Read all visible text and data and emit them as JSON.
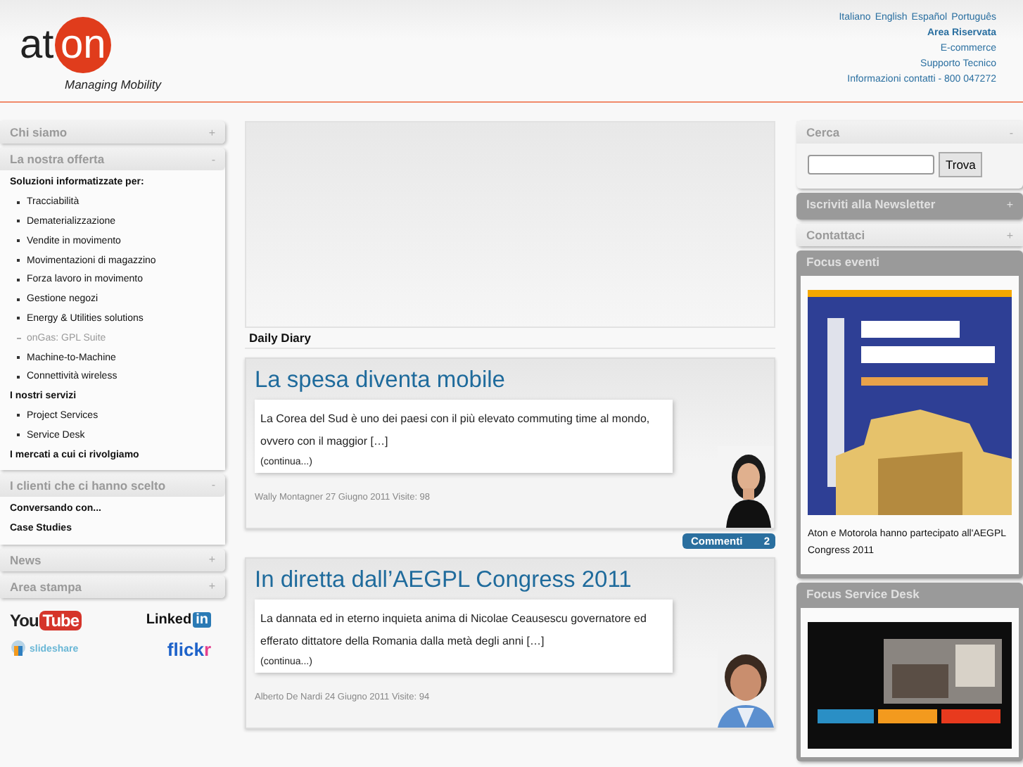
{
  "header": {
    "logo": {
      "text_before": "at",
      "text_circle": "on",
      "tagline": "Managing Mobility"
    },
    "languages": [
      "Italiano",
      "English",
      "Español",
      "Português"
    ],
    "links": [
      {
        "label": "Area Riservata",
        "bold": true
      },
      {
        "label": "E-commerce",
        "bold": false
      },
      {
        "label": "Supporto Tecnico",
        "bold": false
      },
      {
        "label": "Informazioni contatti - 800 047272",
        "bold": false
      }
    ]
  },
  "left_sidebar": {
    "sections": [
      {
        "title": "Chi siamo",
        "toggle": "+",
        "expanded": false
      },
      {
        "title": "La nostra offerta",
        "toggle": "-",
        "expanded": true,
        "items": [
          {
            "kind": "heading",
            "label": "Soluzioni informatizzate per:"
          },
          {
            "kind": "bullet",
            "label": "Tracciabilità"
          },
          {
            "kind": "bullet",
            "label": "Dematerializzazione"
          },
          {
            "kind": "bullet",
            "label": "Vendite in movimento"
          },
          {
            "kind": "bullet",
            "label": "Movimentazioni di magazzino"
          },
          {
            "kind": "bullet",
            "label": "Forza lavoro in movimento"
          },
          {
            "kind": "bullet",
            "label": "Gestione negozi"
          },
          {
            "kind": "bullet",
            "label": "Energy & Utilities solutions"
          },
          {
            "kind": "sub",
            "label": "onGas: GPL Suite"
          },
          {
            "kind": "bullet",
            "label": "Machine-to-Machine"
          },
          {
            "kind": "bullet",
            "label": "Connettività wireless"
          },
          {
            "kind": "heading",
            "label": "I nostri servizi"
          },
          {
            "kind": "bullet",
            "label": "Project Services"
          },
          {
            "kind": "bullet",
            "label": "Service Desk"
          },
          {
            "kind": "heading",
            "label": "I mercati a cui ci rivolgiamo"
          }
        ]
      },
      {
        "title": "I clienti che ci hanno scelto",
        "toggle": "-",
        "expanded": true,
        "items": [
          {
            "kind": "heading",
            "label": "Conversando con..."
          },
          {
            "kind": "heading",
            "label": "Case Studies"
          }
        ]
      },
      {
        "title": "News",
        "toggle": "+",
        "expanded": false
      },
      {
        "title": "Area stampa",
        "toggle": "+",
        "expanded": false
      }
    ],
    "social": [
      {
        "kind": "youtube",
        "parts": [
          "You",
          "Tube"
        ]
      },
      {
        "kind": "linkedin",
        "parts": [
          "Linked",
          "in"
        ]
      },
      {
        "kind": "slideshare",
        "parts": [
          "slideshare"
        ]
      },
      {
        "kind": "flickr",
        "parts": [
          "flick",
          "r"
        ]
      }
    ]
  },
  "main": {
    "section_title": "Daily Diary",
    "posts": [
      {
        "title": "La spesa diventa mobile",
        "excerpt": "La Corea del Sud è uno dei paesi con il più elevato commuting time al mondo, ovvero con il maggior […]",
        "more": "(continua...)",
        "meta": "Wally Montagner 27 Giugno 2011 Visite: 98",
        "comments_label": "Commenti",
        "comments_count": "2"
      },
      {
        "title": "In diretta dall’AEGPL Congress 2011",
        "excerpt": "La dannata ed in eterno inquieta anima di Nicolae Ceausescu governatore ed efferato dittatore della Romania dalla metà degli anni […]",
        "more": "(continua...)",
        "meta": "Alberto De Nardi 24 Giugno 2011 Visite: 94"
      }
    ]
  },
  "right_sidebar": {
    "panels": [
      {
        "kind": "search",
        "title": "Cerca",
        "toggle": "-",
        "button": "Trova"
      },
      {
        "kind": "newsletter",
        "title": "Iscriviti alla Newsletter",
        "toggle": "+"
      },
      {
        "kind": "collapsed",
        "title": "Contattaci",
        "toggle": "+"
      },
      {
        "kind": "banner",
        "title": "Focus eventi",
        "caption": "Aton e Motorola hanno partecipato all'AEGPL Congress 2011"
      },
      {
        "kind": "video",
        "title": "Focus Service Desk"
      }
    ]
  }
}
